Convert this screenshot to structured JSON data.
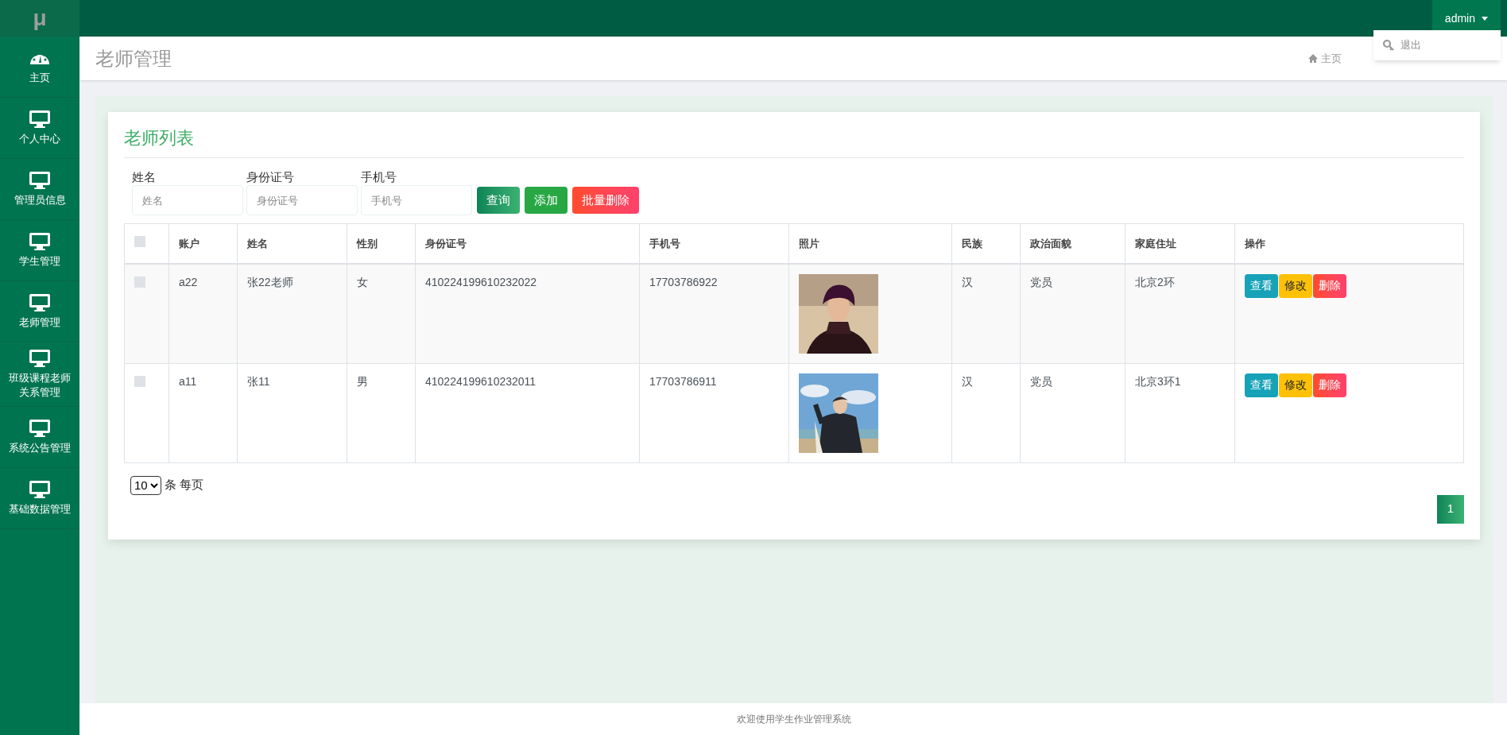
{
  "logo": "μ",
  "user_menu": {
    "label": "admin",
    "expanded": true,
    "items": [
      {
        "label": "退出"
      }
    ]
  },
  "sidebar": {
    "items": [
      {
        "label": "主页",
        "kind": "dashboard"
      },
      {
        "label": "个人中心",
        "kind": "monitor"
      },
      {
        "label": "管理员信息",
        "kind": "monitor"
      },
      {
        "label": "学生管理",
        "kind": "monitor"
      },
      {
        "label": "老师管理",
        "kind": "monitor"
      },
      {
        "label": "班级课程老师关系管理",
        "kind": "monitor"
      },
      {
        "label": "系统公告管理",
        "kind": "monitor"
      },
      {
        "label": "基础数据管理",
        "kind": "monitor"
      }
    ]
  },
  "page_title": "老师管理",
  "breadcrumb": [
    {
      "label": "主页"
    }
  ],
  "card_title": "老师列表",
  "filters": [
    {
      "label": "姓名",
      "placeholder": "姓名"
    },
    {
      "label": "身份证号",
      "placeholder": "身份证号"
    },
    {
      "label": "手机号",
      "placeholder": "手机号"
    }
  ],
  "actions": [
    {
      "label": "查询",
      "kind": "search"
    },
    {
      "label": "添加",
      "kind": "add"
    },
    {
      "label": "批量删除",
      "kind": "delete"
    }
  ],
  "table": {
    "header_checkbox": {
      "checked": false
    },
    "columns": [
      "账户",
      "姓名",
      "性别",
      "身份证号",
      "手机号",
      "照片",
      "民族",
      "政治面貌",
      "家庭住址",
      "操作"
    ],
    "rows": [
      {
        "checked": false,
        "account": "a22",
        "name": "张22老师",
        "gender": "女",
        "id_number": "410224199610232022",
        "phone": "17703786922",
        "ethnicity": "汉",
        "political_status": "党员",
        "address": "北京2环",
        "buttons": [
          {
            "label": "查看",
            "kind": "view"
          },
          {
            "label": "修改",
            "kind": "edit"
          },
          {
            "label": "删除",
            "kind": "delete"
          }
        ]
      },
      {
        "checked": false,
        "account": "a11",
        "name": "张11",
        "gender": "男",
        "id_number": "410224199610232011",
        "phone": "17703786911",
        "ethnicity": "汉",
        "political_status": "党员",
        "address": "北京3环1",
        "buttons": [
          {
            "label": "查看",
            "kind": "view"
          },
          {
            "label": "修改",
            "kind": "edit"
          },
          {
            "label": "删除",
            "kind": "delete"
          }
        ]
      }
    ]
  },
  "pagination": {
    "page_size": "10",
    "suffix": "条 每页",
    "pages": [
      {
        "label": "1",
        "selected": true
      }
    ]
  },
  "footer": "欢迎使用学生作业管理系统"
}
